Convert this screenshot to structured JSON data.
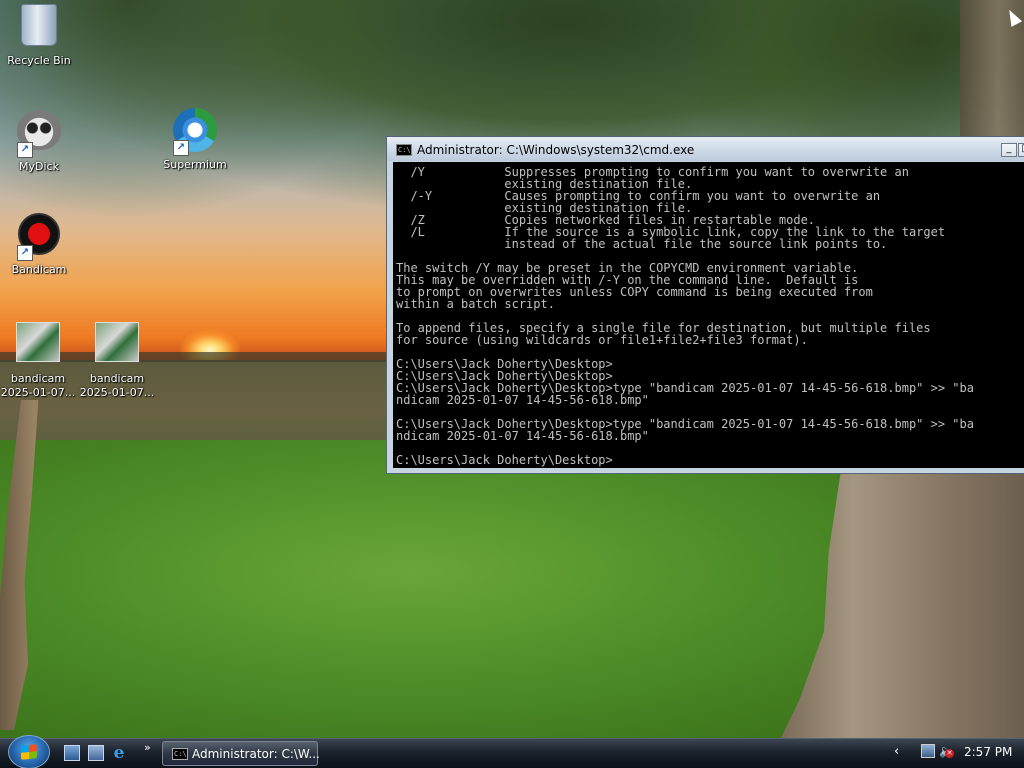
{
  "desktop": {
    "icons": [
      {
        "label": "Recycle Bin",
        "icon": "recycle-bin-icon"
      },
      {
        "label": "MyDick",
        "icon": "raccoon-icon"
      },
      {
        "label": "Supermium",
        "icon": "supermium-browser-icon"
      },
      {
        "label": "Bandicam",
        "icon": "bandicam-record-icon"
      },
      {
        "label": "bandicam",
        "sublabel": "2025-01-07...",
        "icon": "image-thumbnail-icon"
      },
      {
        "label": "bandicam",
        "sublabel": "2025-01-07...",
        "icon": "image-thumbnail-icon"
      }
    ]
  },
  "cmd_window": {
    "title": "Administrator: C:\\Windows\\system32\\cmd.exe",
    "icon_text": "C:\\",
    "lines": [
      "  /Y           Suppresses prompting to confirm you want to overwrite an",
      "               existing destination file.",
      "  /-Y          Causes prompting to confirm you want to overwrite an",
      "               existing destination file.",
      "  /Z           Copies networked files in restartable mode.",
      "  /L           If the source is a symbolic link, copy the link to the target",
      "               instead of the actual file the source link points to.",
      "",
      "The switch /Y may be preset in the COPYCMD environment variable.",
      "This may be overridden with /-Y on the command line.  Default is",
      "to prompt on overwrites unless COPY command is being executed from",
      "within a batch script.",
      "",
      "To append files, specify a single file for destination, but multiple files",
      "for source (using wildcards or file1+file2+file3 format).",
      "",
      "C:\\Users\\Jack Doherty\\Desktop>",
      "C:\\Users\\Jack Doherty\\Desktop>",
      "C:\\Users\\Jack Doherty\\Desktop>type \"bandicam 2025-01-07 14-45-56-618.bmp\" >> \"ba",
      "ndicam 2025-01-07 14-45-56-618.bmp\"",
      "",
      "C:\\Users\\Jack Doherty\\Desktop>type \"bandicam 2025-01-07 14-45-56-618.bmp\" >> \"ba",
      "ndicam 2025-01-07 14-45-56-618.bmp\"",
      "",
      "C:\\Users\\Jack Doherty\\Desktop>"
    ]
  },
  "taskbar": {
    "task_button_label": "Administrator: C:\\W...",
    "task_button_icon_text": "C:\\",
    "quick_launch_more": "»",
    "tray_chevron": "‹",
    "clock": "2:57 PM"
  }
}
